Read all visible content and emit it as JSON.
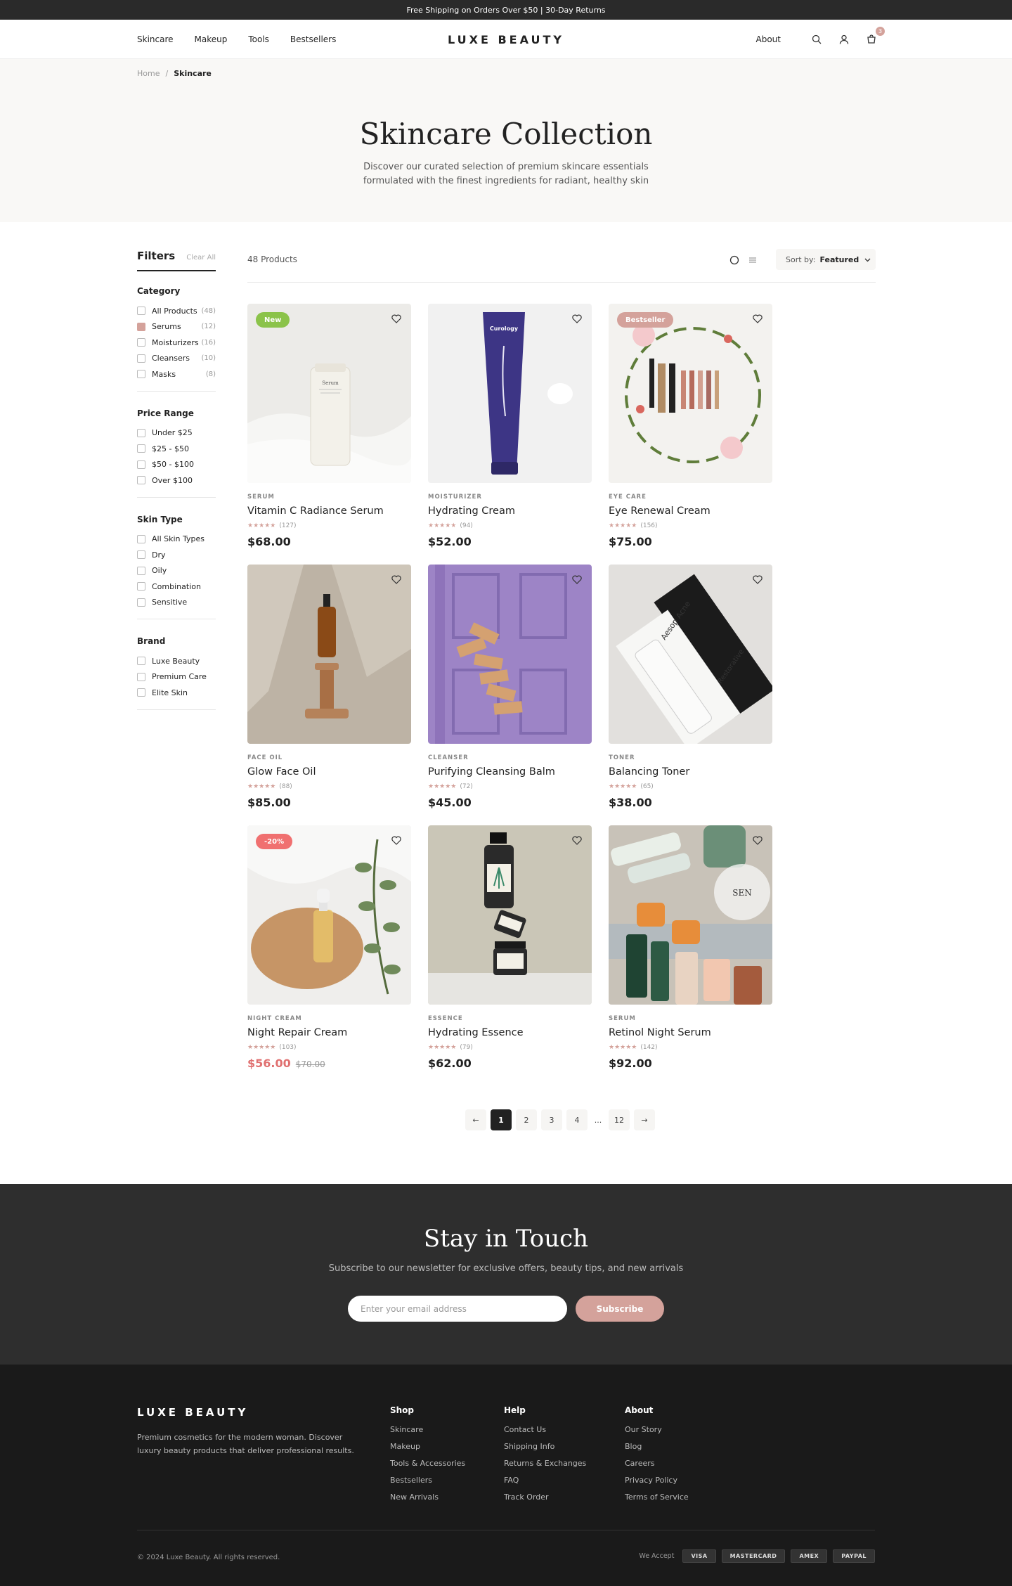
{
  "announcement": "Free Shipping on Orders Over $50 | 30-Day Returns",
  "header": {
    "nav": [
      "Skincare",
      "Makeup",
      "Tools",
      "Bestsellers"
    ],
    "logo": "LUXE BEAUTY",
    "about": "About",
    "cart_count": "3",
    "icons": [
      "search-icon",
      "user-icon",
      "cart-icon"
    ]
  },
  "breadcrumb": {
    "home": "Home",
    "separator": "/",
    "current": "Skincare"
  },
  "hero": {
    "title": "Skincare Collection",
    "description": "Discover our curated selection of premium skincare essentials formulated with the finest ingredients for radiant, healthy skin"
  },
  "filters": {
    "title": "Filters",
    "clear": "Clear All",
    "groups": [
      {
        "title": "Category",
        "options": [
          {
            "label": "All Products",
            "count": "(48)",
            "checked": false
          },
          {
            "label": "Serums",
            "count": "(12)",
            "checked": true
          },
          {
            "label": "Moisturizers",
            "count": "(16)",
            "checked": false
          },
          {
            "label": "Cleansers",
            "count": "(10)",
            "checked": false
          },
          {
            "label": "Masks",
            "count": "(8)",
            "checked": false
          }
        ]
      },
      {
        "title": "Price Range",
        "options": [
          {
            "label": "Under $25"
          },
          {
            "label": "$25 - $50"
          },
          {
            "label": "$50 - $100"
          },
          {
            "label": "Over $100"
          }
        ]
      },
      {
        "title": "Skin Type",
        "options": [
          {
            "label": "All Skin Types"
          },
          {
            "label": "Dry"
          },
          {
            "label": "Oily"
          },
          {
            "label": "Combination"
          },
          {
            "label": "Sensitive"
          }
        ]
      },
      {
        "title": "Brand",
        "options": [
          {
            "label": "Luxe Beauty"
          },
          {
            "label": "Premium Care"
          },
          {
            "label": "Elite Skin"
          }
        ]
      }
    ]
  },
  "toolbar": {
    "count": "48 Products",
    "sort_label": "Sort by:",
    "sort_value": "Featured"
  },
  "products": [
    {
      "category": "SERUM",
      "name": "Vitamin C Radiance Serum",
      "stars": "★★★★★",
      "reviews": "(127)",
      "price": "$68.00",
      "badge": "New",
      "badge_color": "#8bc34a",
      "image": "serum-tube"
    },
    {
      "category": "MOISTURIZER",
      "name": "Hydrating Cream",
      "stars": "★★★★★",
      "reviews": "(94)",
      "price": "$52.00",
      "image": "curology-tube"
    },
    {
      "category": "EYE CARE",
      "name": "Eye Renewal Cream",
      "stars": "★★★★★",
      "reviews": "(156)",
      "price": "$75.00",
      "badge": "Bestseller",
      "badge_color": "#d4a29b",
      "image": "flower-wreath"
    },
    {
      "category": "FACE OIL",
      "name": "Glow Face Oil",
      "stars": "★★★★★",
      "reviews": "(88)",
      "price": "$85.00",
      "image": "amber-bottle"
    },
    {
      "category": "CLEANSER",
      "name": "Purifying Cleansing Balm",
      "stars": "★★★★★",
      "reviews": "(72)",
      "price": "$45.00",
      "image": "purple-door"
    },
    {
      "category": "TONER",
      "name": "Balancing Toner",
      "stars": "★★★★★",
      "reviews": "(65)",
      "price": "$38.00",
      "image": "aesop-box"
    },
    {
      "category": "NIGHT CREAM",
      "name": "Night Repair Cream",
      "stars": "★★★★★",
      "reviews": "(103)",
      "price": "$56.00",
      "old_price": "$70.00",
      "badge": "-20%",
      "badge_color": "#f07070",
      "image": "dropper-leaves"
    },
    {
      "category": "ESSENCE",
      "name": "Hydrating Essence",
      "stars": "★★★★★",
      "reviews": "(79)",
      "price": "$62.00",
      "image": "stacked-jars"
    },
    {
      "category": "SERUM",
      "name": "Retinol Night Serum",
      "stars": "★★★★★",
      "reviews": "(142)",
      "price": "$92.00",
      "image": "product-flatlay"
    }
  ],
  "pagination": {
    "prev": "←",
    "pages": [
      "1",
      "2",
      "3",
      "4"
    ],
    "dots": "...",
    "last": "12",
    "next": "→",
    "active": "1"
  },
  "newsletter": {
    "title": "Stay in Touch",
    "subtitle": "Subscribe to our newsletter for exclusive offers, beauty tips, and new arrivals",
    "placeholder": "Enter your email address",
    "button": "Subscribe"
  },
  "footer": {
    "logo": "LUXE BEAUTY",
    "description": "Premium cosmetics for the modern woman. Discover luxury beauty products that deliver professional results.",
    "columns": [
      {
        "title": "Shop",
        "links": [
          "Skincare",
          "Makeup",
          "Tools & Accessories",
          "Bestsellers",
          "New Arrivals"
        ]
      },
      {
        "title": "Help",
        "links": [
          "Contact Us",
          "Shipping Info",
          "Returns & Exchanges",
          "FAQ",
          "Track Order"
        ]
      },
      {
        "title": "About",
        "links": [
          "Our Story",
          "Blog",
          "Careers",
          "Privacy Policy",
          "Terms of Service"
        ]
      }
    ],
    "copyright": "© 2024 Luxe Beauty. All rights reserved.",
    "we_accept": "We Accept",
    "payments": [
      "VISA",
      "MASTERCARD",
      "AMEX",
      "PAYPAL"
    ]
  },
  "colors": {
    "accent": "#d4a29b",
    "dark": "#2a2a2a",
    "sale": "#e07070"
  }
}
